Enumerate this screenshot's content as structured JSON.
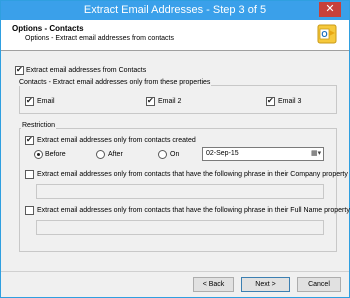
{
  "window": {
    "title": "Extract Email Addresses - Step 3 of 5",
    "close_glyph": "✕"
  },
  "header": {
    "title": "Options - Contacts",
    "subtitle": "Options - Extract email addresses from contacts",
    "icon": "outlook-icon"
  },
  "options": {
    "extract_from_contacts": {
      "label": "Extract email addresses from Contacts",
      "checked": true
    },
    "contacts_group": {
      "title": "Contacts - Extract email addresses only from these properties",
      "email": {
        "label": "Email",
        "checked": true
      },
      "email2": {
        "label": "Email 2",
        "checked": true
      },
      "email3": {
        "label": "Email 3",
        "checked": true
      }
    },
    "restriction_group": {
      "title": "Restriction",
      "created": {
        "label": "Extract email addresses only from contacts created",
        "checked": true
      },
      "before": {
        "label": "Before",
        "selected": true
      },
      "after": {
        "label": "After",
        "selected": false
      },
      "on": {
        "label": "On",
        "selected": false
      },
      "date_value": "02-Sep-15",
      "company": {
        "label": "Extract email addresses only from contacts that have the following phrase in their Company property",
        "checked": false,
        "value": ""
      },
      "fullname": {
        "label": "Extract email addresses only from contacts that have the following phrase in their Full Name property",
        "checked": false,
        "value": ""
      }
    }
  },
  "buttons": {
    "back": "< Back",
    "next": "Next >",
    "cancel": "Cancel"
  }
}
